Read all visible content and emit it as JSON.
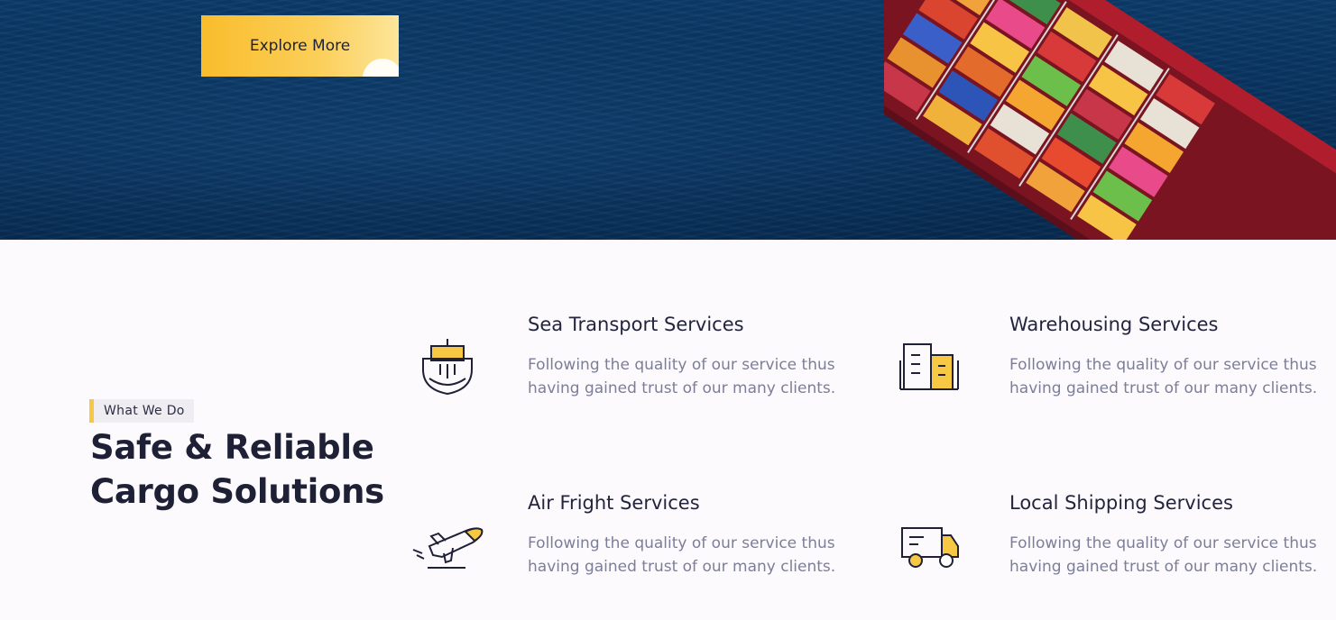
{
  "hero": {
    "button_label": "Explore More"
  },
  "section": {
    "tag": "What We Do",
    "title_line1": "Safe & Reliable",
    "title_line2": "Cargo Solutions"
  },
  "services": [
    {
      "title": "Sea Transport Services",
      "description": "Following the quality of our service thus having gained trust of our many clients.",
      "icon": "ship-icon"
    },
    {
      "title": "Warehousing Services",
      "description": "Following the quality of our service thus having gained trust of our many clients.",
      "icon": "warehouse-icon"
    },
    {
      "title": "Air Fright Services",
      "description": "Following the quality of our service thus having gained trust of our many clients.",
      "icon": "airplane-icon"
    },
    {
      "title": "Local Shipping Services",
      "description": "Following the quality of our service thus having gained trust of our many clients.",
      "icon": "truck-icon"
    }
  ],
  "colors": {
    "accent": "#f9bd2c",
    "heading": "#1e2036",
    "body_text": "#7b7e98",
    "hero_sea": "#08335f",
    "background": "#fdfafe"
  }
}
